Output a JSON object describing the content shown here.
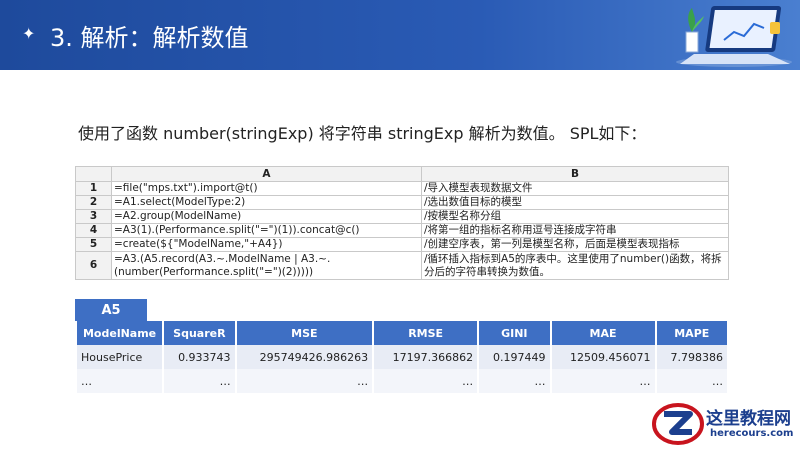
{
  "header": {
    "title": "3. 解析：解析数值"
  },
  "intro": {
    "text": "使用了函数 number(stringExp) 将字符串 stringExp 解析为数值。 SPL如下："
  },
  "code_table": {
    "headers": [
      "A",
      "B"
    ],
    "rows": [
      {
        "n": "1",
        "a": "=file(\"mps.txt\").import@t()",
        "b": "/导入模型表现数据文件"
      },
      {
        "n": "2",
        "a": "=A1.select(ModelType:2)",
        "b": "/选出数值目标的模型"
      },
      {
        "n": "3",
        "a": "=A2.group(ModelName)",
        "b": "/按模型名称分组"
      },
      {
        "n": "4",
        "a": "=A3(1).(Performance.split(\"=\")(1)).concat@c()",
        "b": "/将第一组的指标名称用逗号连接成字符串"
      },
      {
        "n": "5",
        "a": "=create(${\"ModelName,\"+A4})",
        "b": "/创建空序表，第一列是模型名称，后面是模型表现指标"
      },
      {
        "n": "6",
        "a": "=A3.(A5.record(A3.~.ModelName | A3.~.(number(Performance.split(\"=\")(2)))))",
        "b": "/循环插入指标到A5的序表中。这里使用了number()函数，将拆分后的字符串转换为数值。"
      }
    ]
  },
  "result": {
    "label": "A5",
    "columns": [
      "ModelName",
      "SquareR",
      "MSE",
      "RMSE",
      "GINI",
      "MAE",
      "MAPE"
    ],
    "rows": [
      [
        "HousePrice",
        "0.933743",
        "295749426.986263",
        "17197.366862",
        "0.197449",
        "12509.456071",
        "7.798386"
      ],
      [
        "…",
        "…",
        "…",
        "…",
        "…",
        "…",
        "…"
      ]
    ]
  },
  "logo": {
    "main": "这里教程网",
    "sub": "herecours.com"
  },
  "colors": {
    "header": "#1e4a9c",
    "table_header": "#3e6fc4",
    "logo_red": "#c8141e"
  }
}
